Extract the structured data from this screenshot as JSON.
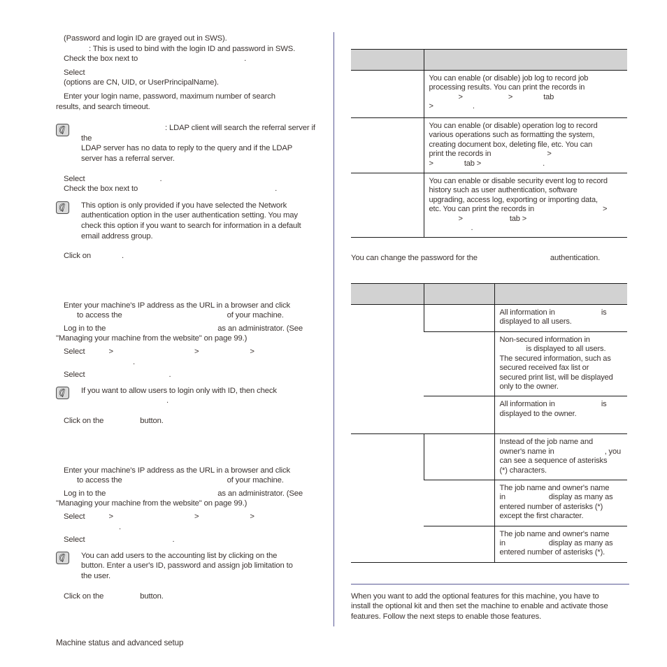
{
  "document": {
    "footer_text": "Machine status and advanced setup",
    "divider_color": "#5a5a96",
    "text_color": "#3b3330",
    "table_header_fill": "#d2d2d2"
  },
  "left_column": {
    "block_ldap": {
      "lines": [
        "(Password and login ID are grayed out in SWS).",
        ": This is used to bind with the login ID and password in SWS.",
        "Check the box next to",
        ".",
        "Select",
        "(options are CN, UID, or UserPrincipalName).",
        "Enter your login name, password, maximum number of search",
        "results, and search timeout."
      ],
      "line1": "(Password and login ID are grayed out in SWS).",
      "line2": ": This is used to bind with the login ID and password in SWS.",
      "line3a": "Check the box next to",
      "line3b": ".",
      "line4": "Select",
      "line5": "(options are CN, UID, or UserPrincipalName).",
      "line6": "Enter your login name, password, maximum number of search",
      "line7": "results, and search timeout."
    },
    "note_referral": {
      "line1": ": LDAP client will search the referral server if the",
      "line2": "LDAP server has no data to reply to the query and if the LDAP",
      "line3": "server has a referral server."
    },
    "block_select": {
      "line1a": "Select",
      "line1b": ".",
      "line2a": "Check the box next to",
      "line2b": "."
    },
    "note_network_auth": {
      "line1": "This option is only provided if you have selected the Network",
      "line2": "authentication option in the user authentication setting. You may",
      "line3": "check this option if you want to search for information in a default",
      "line4": "email address group."
    },
    "block_click_on": {
      "line1a": "Click on",
      "line1b": "."
    },
    "proc_one": {
      "l1": "Enter your machine's IP address as the URL in a browser and click",
      "l2a": "to access the",
      "l2b": "of your machine.",
      "l3a": "Log in to the",
      "l3b": "as an administrator. (See",
      "l4": "\"Managing your machine from the website\" on page 99.)",
      "l5a": "Select",
      "l5b": ">",
      "l5c": ">",
      "l5d": ">",
      "l6": ".",
      "l7a": "Select",
      "l7b": "."
    },
    "note_login_id": {
      "line1": "If you want to allow users to login only with ID, then check",
      "line2": "."
    },
    "click_apply_1": {
      "a": "Click on the",
      "b": "button."
    },
    "proc_two": {
      "l1": "Enter your machine's IP address as the URL in a browser and click",
      "l2a": "to access the",
      "l2b": "of your machine.",
      "l3a": "Log in to the",
      "l3b": "as an administrator. (See",
      "l4": "\"Managing your machine from the website\" on page 99.)",
      "l5a": "Select",
      "l5b": ">",
      "l5c": ">",
      "l5d": ">",
      "l6": ".",
      "l7a": "Select",
      "l7b": "."
    },
    "note_accounting": {
      "line1": "You can add users to the accounting list by clicking on the",
      "line2": "button. Enter a user's ID, password and assign job limitation to",
      "line3": "the user."
    },
    "click_apply_2": {
      "a": "Click on the",
      "b": "button."
    }
  },
  "right_column": {
    "table_log": {
      "headers": [
        "",
        ""
      ],
      "rows": [
        {
          "option": "",
          "description_lines": [
            "You can enable (or disable) job log to record job",
            "processing results. You can print the records in",
            ">                                >                        tab",
            ">                          ."
          ],
          "d1": "You can enable (or disable) job log to record job",
          "d2": "processing results. You can print the records in",
          "d3_gt1": ">",
          "d3_gt2": ">",
          "d3_tab": "tab",
          "d4_gt": ">",
          "d4_dot": "."
        },
        {
          "option": "",
          "d1": "You can enable (or disable) operation log to record",
          "d2": "various operations such as formatting the system,",
          "d3": "creating document box, deleting file, etc. You can",
          "d4a": "print the records in",
          "d4b": ">",
          "d5a": ">",
          "d5b": "tab >",
          "d5c": "."
        },
        {
          "option": "",
          "d1": "You can enable or disable security event log to record",
          "d2": "history such as user authentication, software",
          "d3": "upgrading, access log, exporting or importing data,",
          "d4a": "etc. You can print the records in",
          "d4b": ">",
          "d5a": ">",
          "d5b": "tab >",
          "d6": "."
        }
      ]
    },
    "password_para": {
      "a": "You can change the password for the",
      "b": "authentication."
    },
    "table_display": {
      "headers": [
        "",
        "",
        ""
      ],
      "rows": [
        {
          "col1": "",
          "col2": "",
          "d1a": "All information in",
          "d1b": "is",
          "d2": "displayed to all users."
        },
        {
          "col1": "",
          "col2": "",
          "d1": "Non-secured information in",
          "d2": "is displayed to all users.",
          "d3": "The secured information, such as",
          "d4": "secured received fax list or",
          "d5": "secured print list, will be displayed",
          "d6": "only to the owner."
        },
        {
          "col1": "",
          "col2": "",
          "d1a": "All information in",
          "d1b": "is",
          "d2": "displayed to the owner."
        },
        {
          "col1": "",
          "col2": "",
          "d1": "Instead of the job name and",
          "d2a": "owner's name in",
          "d2b": ", you",
          "d3": "can see a sequence of asterisks",
          "d4": "(*) characters."
        },
        {
          "col1": "",
          "col2": "",
          "d1": "The job name and owner's name",
          "d2a": "in",
          "d2b": "display as many as",
          "d3": "entered number of asterisks (*)",
          "d4": "except the first character."
        },
        {
          "col1": "",
          "col2": "",
          "d1": "The job name and owner's name",
          "d2a": "in",
          "d2b": "display as many as",
          "d3": "entered number of asterisks (*)."
        }
      ]
    },
    "optional_features": {
      "l1": "When you want to add the optional features for this machine, you have to",
      "l2": "install the optional kit and then set the machine to enable and activate those",
      "l3": "features. Follow the next steps to enable those features."
    }
  }
}
